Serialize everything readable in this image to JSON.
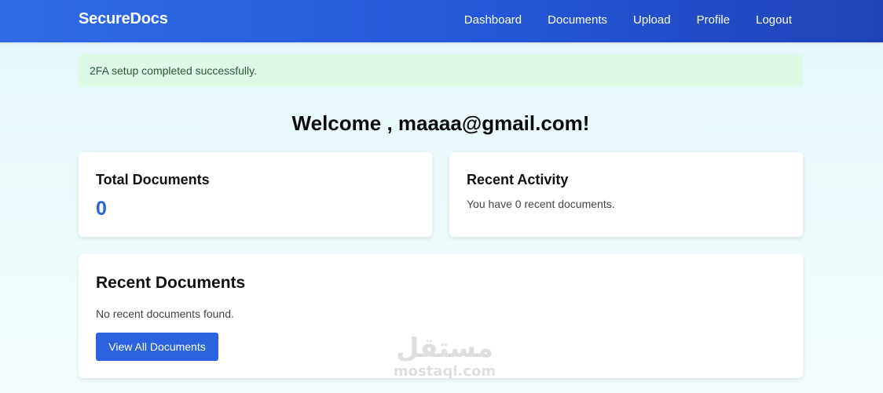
{
  "navbar": {
    "brand": "SecureDocs",
    "links": [
      "Dashboard",
      "Documents",
      "Upload",
      "Profile",
      "Logout"
    ]
  },
  "alert": {
    "message": "2FA setup completed successfully."
  },
  "welcome": {
    "title": "Welcome , maaaa@gmail.com!"
  },
  "stats": {
    "total_documents": {
      "label": "Total Documents",
      "value": "0"
    },
    "recent_activity": {
      "label": "Recent Activity",
      "text": "You have 0 recent documents."
    }
  },
  "recent_documents": {
    "title": "Recent Documents",
    "empty_text": "No recent documents found.",
    "button_label": "View All Documents"
  },
  "watermark": {
    "arabic": "مستقل",
    "latin": "mostaql.com"
  },
  "colors": {
    "primary": "#2a63dd",
    "alert_bg": "#ddfae6",
    "nav_start": "#2f6be6",
    "nav_end": "#1e43b8"
  }
}
